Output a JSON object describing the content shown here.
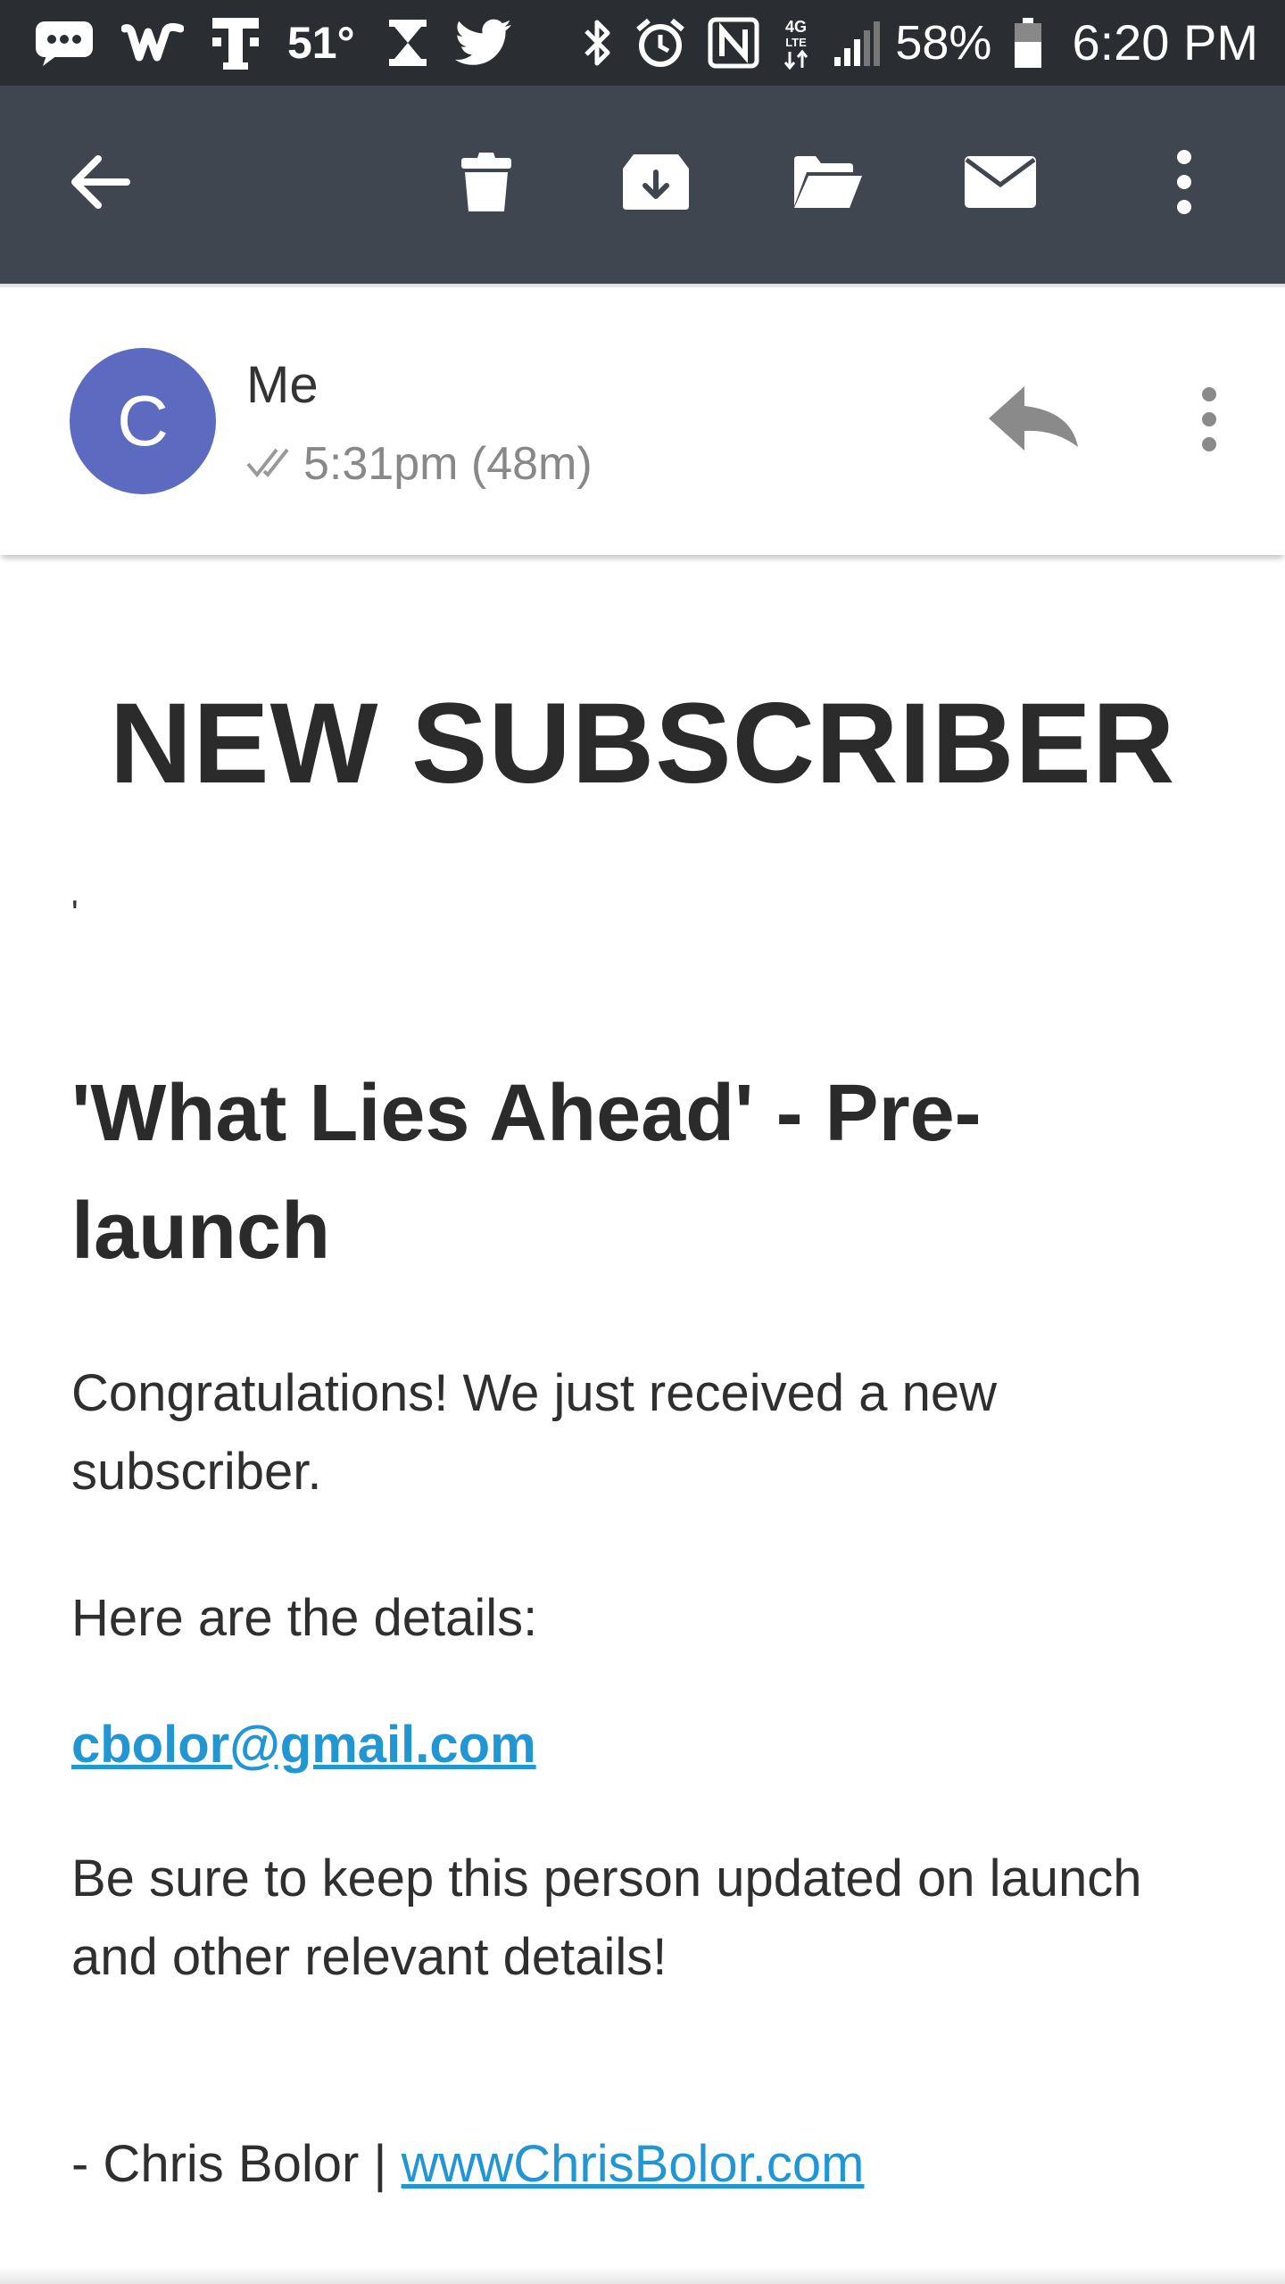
{
  "status_bar": {
    "temperature": "51°",
    "battery": "58%",
    "time": "6:20 PM",
    "network_label": "4G LTE",
    "left_icons": [
      "messages-icon",
      "w-app-icon",
      "tmobile-icon",
      "temperature-icon",
      "hourglass-icon",
      "twitter-icon"
    ],
    "right_icons": [
      "bluetooth-icon",
      "alarm-icon",
      "nfc-icon",
      "network-icon",
      "signal-icon",
      "battery-icon"
    ]
  },
  "toolbar": {
    "icons": [
      "back-arrow-icon",
      "trash-icon",
      "archive-icon",
      "folder-icon",
      "mail-icon",
      "more-vert-icon"
    ]
  },
  "sender": {
    "avatar_letter": "C",
    "name": "Me",
    "time": "5:31pm (48m)",
    "avatar_color": "#5c6bc0",
    "icons": [
      "double-check-icon",
      "reply-icon",
      "more-vert-icon"
    ]
  },
  "email": {
    "title": "NEW SUBSCRIBER",
    "stray_mark": "'",
    "subtitle": "'What Lies Ahead' - Pre-launch",
    "congrats": "Congratulations! We just received a new subscriber.",
    "details_intro": "Here are the details:",
    "subscriber_email": "cbolor@gmail.com",
    "keep_updated": "Be sure to keep this person updated on launch and other relevant details!",
    "signature_text": "- Chris Bolor | ",
    "signature_link": "wwwChrisBolor.com",
    "link_color": "#2196d3"
  },
  "colors": {
    "status_bar_bg": "#2a2e33",
    "toolbar_bg": "#40464f"
  }
}
